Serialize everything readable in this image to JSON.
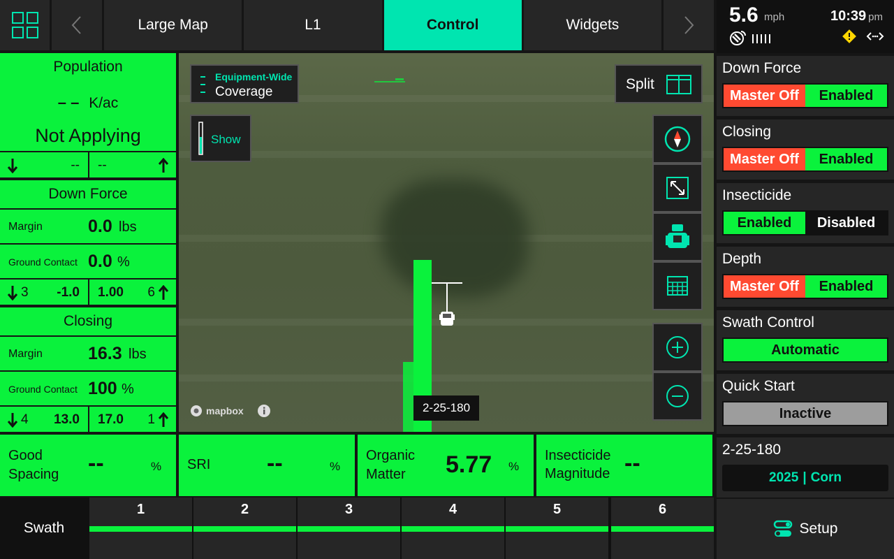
{
  "topnav": {
    "tabs": [
      "Large Map",
      "L1",
      "Control",
      "Widgets"
    ],
    "active_tab": "Control"
  },
  "status": {
    "speed": "5.6",
    "speed_unit": "mph",
    "time": "10:39",
    "ampm": "pm"
  },
  "left": {
    "population": {
      "title": "Population",
      "value": "– –",
      "unit": "K/ac",
      "state": "Not Applying",
      "range_low": "--",
      "range_high": "--"
    },
    "down_force": {
      "title": "Down Force",
      "margin_label": "Margin",
      "margin_value": "0.0",
      "margin_unit": "lbs",
      "gc_label": "Ground Contact",
      "gc_value": "0.0",
      "gc_unit": "%",
      "low_count": "3",
      "low_value": "-1.0",
      "high_value": "1.00",
      "high_count": "6"
    },
    "closing": {
      "title": "Closing",
      "margin_label": "Margin",
      "margin_value": "16.3",
      "margin_unit": "lbs",
      "gc_label": "Ground Contact",
      "gc_value": "100",
      "gc_unit": "%",
      "low_count": "4",
      "low_value": "13.0",
      "high_value": "17.0",
      "high_count": "1"
    }
  },
  "map": {
    "coverage_small": "Equipment-Wide",
    "coverage_big": "Coverage",
    "show_label": "Show",
    "split_label": "Split",
    "field_label": "2-25-180",
    "mapbox_label": "mapbox"
  },
  "right": {
    "down_force": {
      "title": "Down Force",
      "left": "Master Off",
      "right": "Enabled"
    },
    "closing": {
      "title": "Closing",
      "left": "Master Off",
      "right": "Enabled"
    },
    "insecticide": {
      "title": "Insecticide",
      "left": "Enabled",
      "right": "Disabled"
    },
    "depth": {
      "title": "Depth",
      "left": "Master Off",
      "right": "Enabled"
    },
    "swath_control": {
      "title": "Swath Control",
      "value": "Automatic"
    },
    "quick_start": {
      "title": "Quick Start",
      "value": "Inactive"
    },
    "field": {
      "title": "2-25-180",
      "year": "2025",
      "separator": "|",
      "crop": "Corn"
    },
    "setup_label": "Setup"
  },
  "metrics": [
    {
      "label1": "Good",
      "label2": "Spacing",
      "value": "--",
      "unit": "%"
    },
    {
      "label1": "SRI",
      "label2": "",
      "value": "--",
      "unit": "%"
    },
    {
      "label1": "Organic",
      "label2": "Matter",
      "value": "5.77",
      "unit": "%"
    },
    {
      "label1": "Insecticide",
      "label2": "Magnitude",
      "value": "--",
      "unit": ""
    }
  ],
  "swath": {
    "label": "Swath",
    "sections": [
      "1",
      "2",
      "3",
      "4",
      "5",
      "6"
    ]
  },
  "colors": {
    "accent": "#00e5b0",
    "green": "#0af23c",
    "red": "#ff4a31",
    "panel": "#262626"
  }
}
